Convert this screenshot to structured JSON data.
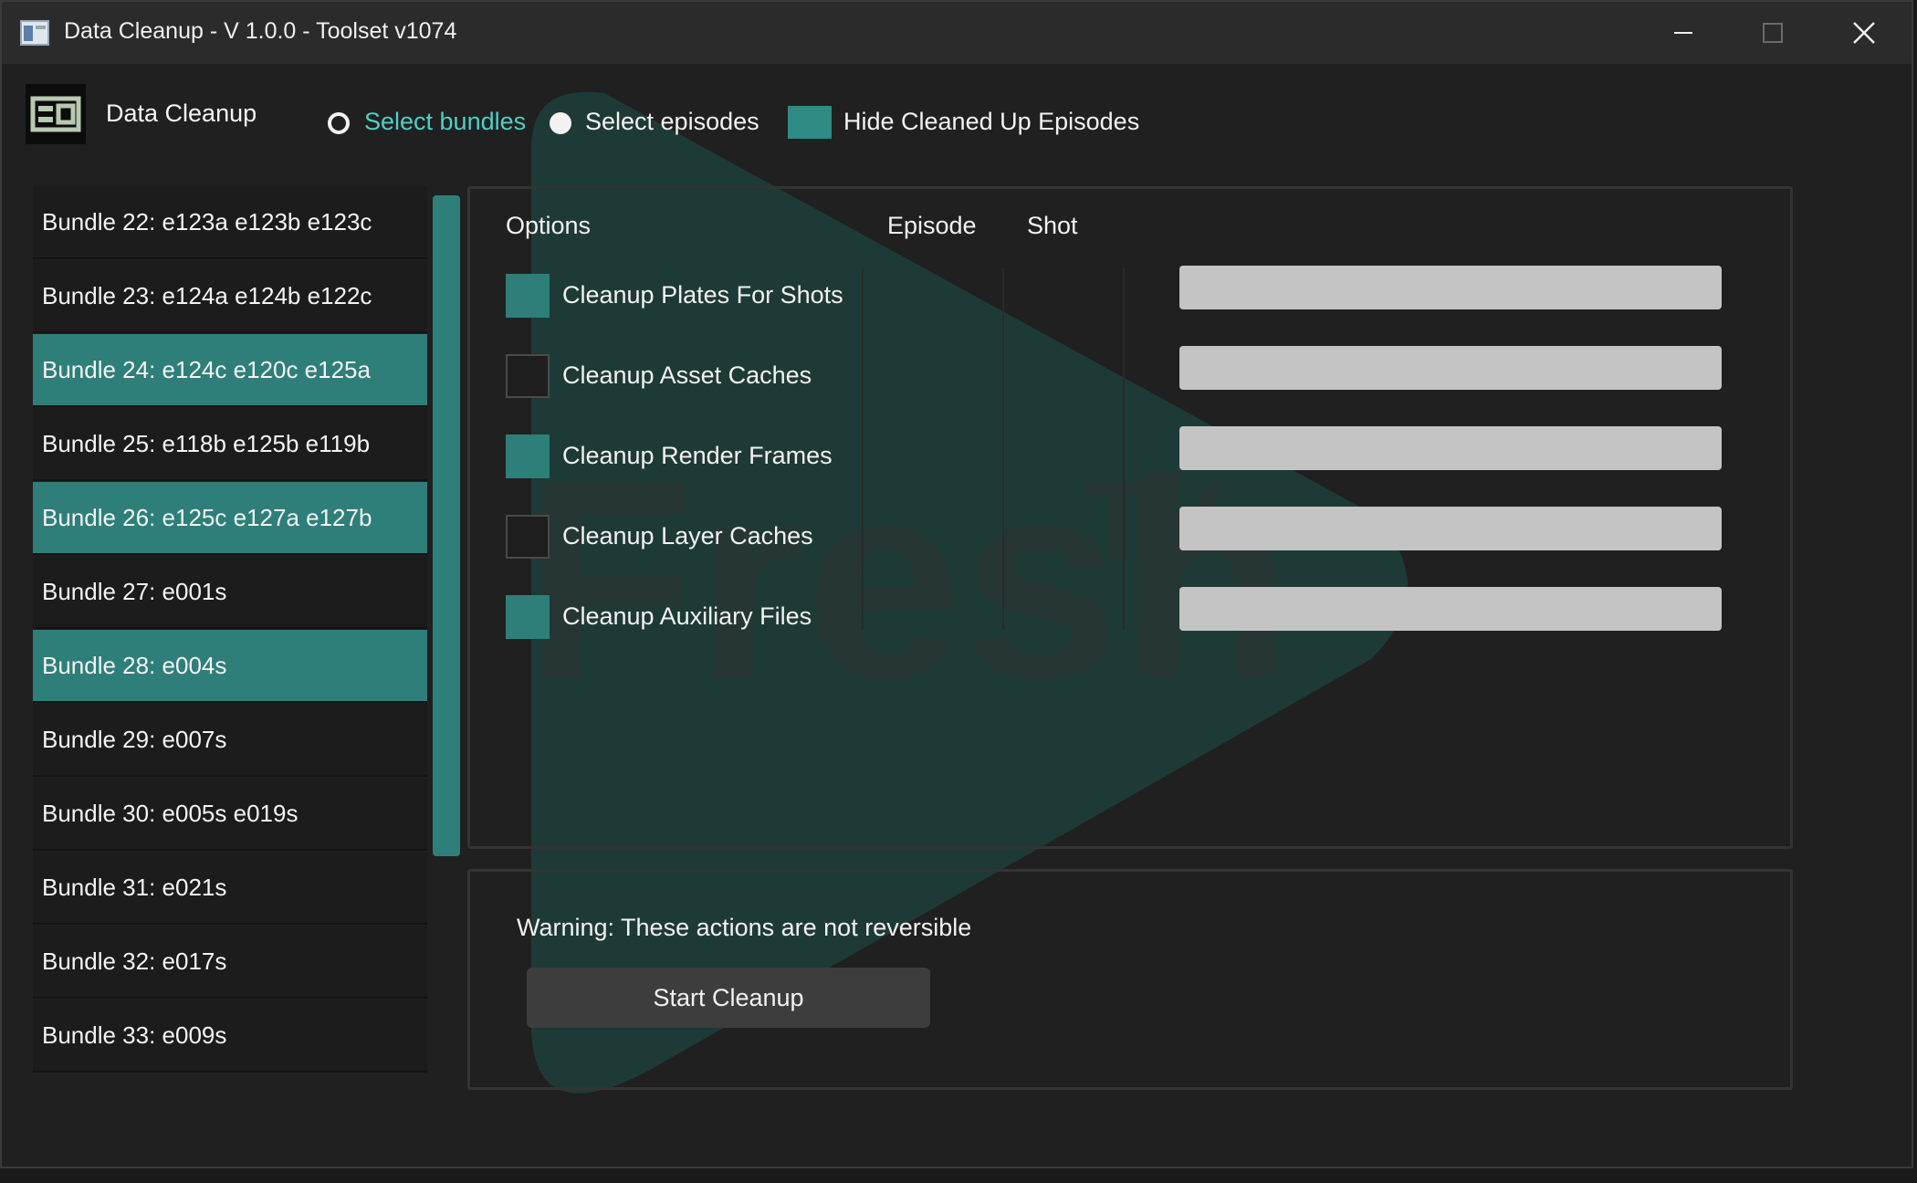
{
  "window": {
    "title": "Data Cleanup - V 1.0.0 - Toolset v1074"
  },
  "header": {
    "app_name": "Data Cleanup",
    "logo_text": "ea",
    "mode_bundles": "Select bundles",
    "mode_episodes": "Select episodes",
    "hide_cleaned": "Hide Cleaned Up Episodes",
    "selected_mode": "Select bundles"
  },
  "bundles": [
    {
      "label": "Bundle 22: e123a e123b e123c",
      "selected": false
    },
    {
      "label": "Bundle 23: e124a e124b e122c",
      "selected": false
    },
    {
      "label": "Bundle 24: e124c e120c e125a",
      "selected": true
    },
    {
      "label": "Bundle 25: e118b e125b e119b",
      "selected": false
    },
    {
      "label": "Bundle 26: e125c e127a e127b",
      "selected": true
    },
    {
      "label": "Bundle 27: e001s",
      "selected": false
    },
    {
      "label": "Bundle 28: e004s",
      "selected": true
    },
    {
      "label": "Bundle 29: e007s",
      "selected": false
    },
    {
      "label": "Bundle 30: e005s e019s",
      "selected": false
    },
    {
      "label": "Bundle 31: e021s",
      "selected": false
    },
    {
      "label": "Bundle 32: e017s",
      "selected": false
    },
    {
      "label": "Bundle 33: e009s",
      "selected": false
    }
  ],
  "options_panel": {
    "col_options": "Options",
    "col_episode": "Episode",
    "col_shot": "Shot",
    "items": [
      {
        "label": "Cleanup Plates For Shots",
        "checked": true
      },
      {
        "label": "Cleanup Asset Caches",
        "checked": false
      },
      {
        "label": "Cleanup Render Frames",
        "checked": true
      },
      {
        "label": "Cleanup Layer Caches",
        "checked": false
      },
      {
        "label": "Cleanup Auxiliary Files",
        "checked": true
      }
    ]
  },
  "action_panel": {
    "warning": "Warning: These actions are not reversible",
    "start_button": "Start Cleanup"
  },
  "watermark": {
    "text": "Fresh",
    "superscript": "TV"
  },
  "colors": {
    "accent": "#2e7f79",
    "accent_text": "#4fd0c4",
    "background": "#202020",
    "titlebar": "#2b2b2b",
    "progress_bar": "#c4c4c4"
  }
}
